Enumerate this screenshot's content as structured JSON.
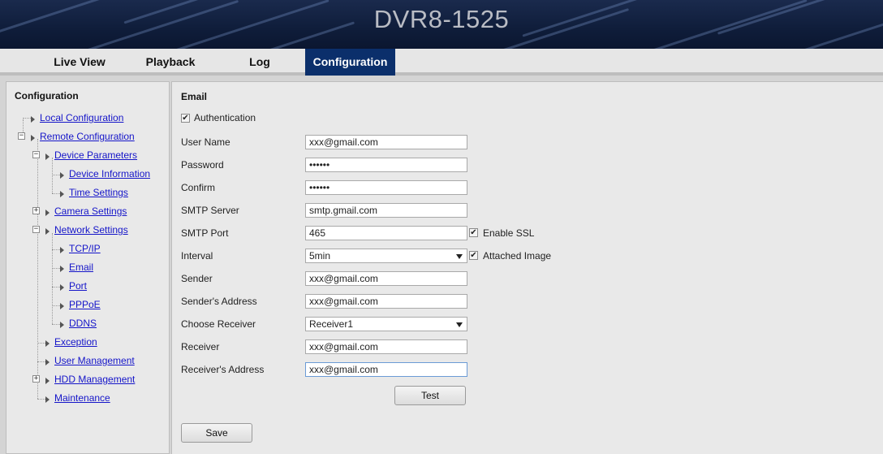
{
  "header": {
    "title": "DVR8-1525"
  },
  "nav": {
    "tabs": [
      {
        "label": "Live View",
        "active": false
      },
      {
        "label": "Playback",
        "active": false
      },
      {
        "label": "Log",
        "active": false
      },
      {
        "label": "Configuration",
        "active": true
      }
    ]
  },
  "sidebar": {
    "title": "Configuration",
    "items": [
      {
        "label": "Local Configuration"
      },
      {
        "label": "Remote Configuration"
      },
      {
        "label": "Device Parameters"
      },
      {
        "label": "Device Information"
      },
      {
        "label": "Time Settings"
      },
      {
        "label": "Camera Settings"
      },
      {
        "label": "Network Settings"
      },
      {
        "label": "TCP/IP"
      },
      {
        "label": "Email"
      },
      {
        "label": "Port"
      },
      {
        "label": "PPPoE"
      },
      {
        "label": "DDNS"
      },
      {
        "label": "Exception"
      },
      {
        "label": "User Management"
      },
      {
        "label": "HDD Management"
      },
      {
        "label": "Maintenance"
      }
    ]
  },
  "email": {
    "title": "Email",
    "authentication": {
      "label": "Authentication",
      "checked": true
    },
    "user_name": {
      "label": "User Name",
      "value": "xxx@gmail.com"
    },
    "password": {
      "label": "Password",
      "value": "••••••"
    },
    "confirm": {
      "label": "Confirm",
      "value": "••••••"
    },
    "smtp_server": {
      "label": "SMTP Server",
      "value": "smtp.gmail.com"
    },
    "smtp_port": {
      "label": "SMTP Port",
      "value": "465"
    },
    "enable_ssl": {
      "label": "Enable SSL",
      "checked": true
    },
    "interval": {
      "label": "Interval",
      "value": "5min"
    },
    "attached_image": {
      "label": "Attached Image",
      "checked": true
    },
    "sender": {
      "label": "Sender",
      "value": "xxx@gmail.com"
    },
    "sender_address": {
      "label": "Sender's Address",
      "value": "xxx@gmail.com"
    },
    "choose_receiver": {
      "label": "Choose Receiver",
      "value": "Receiver1"
    },
    "receiver": {
      "label": "Receiver",
      "value": "xxx@gmail.com"
    },
    "receiver_address": {
      "label": "Receiver's Address",
      "value": "xxx@gmail.com"
    },
    "test_label": "Test",
    "save_label": "Save"
  },
  "icons": {
    "check": "✔",
    "expand_plus": "+",
    "expand_minus": "−"
  },
  "colors": {
    "header_bg": "#0f1d3a",
    "active_tab": "#0b2f6b",
    "link": "#1515c9"
  }
}
